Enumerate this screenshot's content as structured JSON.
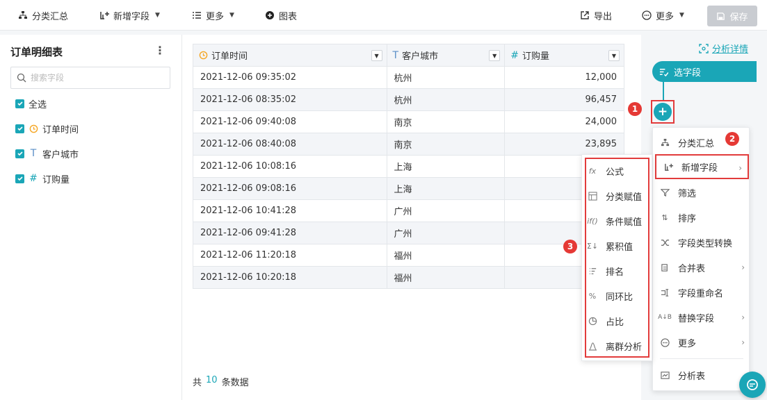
{
  "toolbar": {
    "group_summary": "分类汇总",
    "add_field": "新增字段",
    "more": "更多",
    "chart": "图表",
    "export": "导出",
    "more_right": "更多",
    "save": "保存"
  },
  "left_panel": {
    "title": "订单明细表",
    "search_placeholder": "搜索字段",
    "select_all": "全选",
    "fields": [
      {
        "label": "订单时间",
        "type": "date"
      },
      {
        "label": "客户城市",
        "type": "text"
      },
      {
        "label": "订购量",
        "type": "number"
      }
    ]
  },
  "table": {
    "columns": [
      "订单时间",
      "客户城市",
      "订购量"
    ],
    "rows": [
      [
        "2021-12-06 09:35:02",
        "杭州",
        "12,000"
      ],
      [
        "2021-12-06 08:35:02",
        "杭州",
        "96,457"
      ],
      [
        "2021-12-06 09:40:08",
        "南京",
        "24,000"
      ],
      [
        "2021-12-06 08:40:08",
        "南京",
        "23,895"
      ],
      [
        "2021-12-06 10:08:16",
        "上海",
        ""
      ],
      [
        "2021-12-06 09:08:16",
        "上海",
        ""
      ],
      [
        "2021-12-06 10:41:28",
        "广州",
        ""
      ],
      [
        "2021-12-06 09:41:28",
        "广州",
        ""
      ],
      [
        "2021-12-06 11:20:18",
        "福州",
        ""
      ],
      [
        "2021-12-06 10:20:18",
        "福州",
        ""
      ]
    ],
    "count_prefix": "共",
    "count_value": "10",
    "count_suffix": "条数据"
  },
  "flow": {
    "detail_link": "分析详情",
    "step_label": "选字段",
    "plus": "+"
  },
  "badges": [
    "1",
    "2",
    "3"
  ],
  "menu": {
    "items": [
      {
        "label": "分类汇总",
        "icon": "hierarchy-icon",
        "submenu": false
      },
      {
        "label": "新增字段",
        "icon": "add-field-icon",
        "submenu": true
      },
      {
        "label": "筛选",
        "icon": "filter-icon",
        "submenu": false
      },
      {
        "label": "排序",
        "icon": "sort-icon",
        "submenu": false
      },
      {
        "label": "字段类型转换",
        "icon": "shuffle-icon",
        "submenu": false
      },
      {
        "label": "合并表",
        "icon": "merge-icon",
        "submenu": true
      },
      {
        "label": "字段重命名",
        "icon": "rename-icon",
        "submenu": false
      },
      {
        "label": "替换字段",
        "icon": "replace-icon",
        "submenu": true
      },
      {
        "label": "更多",
        "icon": "more-circle-icon",
        "submenu": true
      },
      {
        "label": "分析表",
        "icon": "analysis-table-icon",
        "submenu": false
      }
    ]
  },
  "submenu": {
    "items": [
      {
        "label": "公式",
        "icon": "formula-icon"
      },
      {
        "label": "分类赋值",
        "icon": "category-assign-icon"
      },
      {
        "label": "条件赋值",
        "icon": "condition-assign-icon"
      },
      {
        "label": "累积值",
        "icon": "cumulative-icon"
      },
      {
        "label": "排名",
        "icon": "rank-icon"
      },
      {
        "label": "同环比",
        "icon": "percent-icon"
      },
      {
        "label": "占比",
        "icon": "pie-icon"
      },
      {
        "label": "离群分析",
        "icon": "outlier-icon"
      }
    ]
  },
  "colors": {
    "accent": "#1aa6b7",
    "highlight": "#e23b3b",
    "badge": "#e53935",
    "date_icon": "#f5a623"
  }
}
